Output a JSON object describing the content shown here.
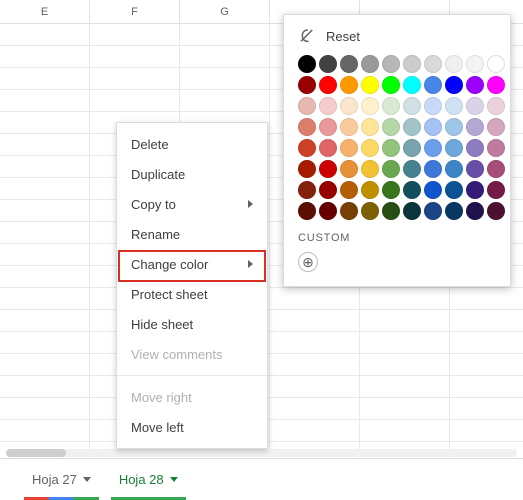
{
  "columns": [
    "E",
    "F",
    "G"
  ],
  "tabs": [
    {
      "label": "Hoja 27",
      "active": false
    },
    {
      "label": "Hoja 28",
      "active": true
    }
  ],
  "context_menu": {
    "delete": "Delete",
    "duplicate": "Duplicate",
    "copy_to": "Copy to",
    "rename": "Rename",
    "change_color": "Change color",
    "protect": "Protect sheet",
    "hide": "Hide sheet",
    "view_comments": "View comments",
    "move_right": "Move right",
    "move_left": "Move left"
  },
  "color_picker": {
    "reset": "Reset",
    "custom_label": "CUSTOM"
  },
  "chart_data": {
    "type": "table",
    "title": "Color swatches",
    "columns": 10,
    "rows": [
      [
        "#000000",
        "#434343",
        "#666666",
        "#999999",
        "#b7b7b7",
        "#cccccc",
        "#d9d9d9",
        "#efefef",
        "#f3f3f3",
        "#ffffff"
      ],
      [
        "#980000",
        "#ff0000",
        "#ff9900",
        "#ffff00",
        "#00ff00",
        "#00ffff",
        "#4a86e8",
        "#0000ff",
        "#9900ff",
        "#ff00ff"
      ],
      [
        "#e6b8af",
        "#f4cccc",
        "#fce5cd",
        "#fff2cc",
        "#d9ead3",
        "#d0e0e3",
        "#c9daf8",
        "#cfe2f3",
        "#d9d2e9",
        "#ead1dc"
      ],
      [
        "#dd7e6b",
        "#ea9999",
        "#f9cb9c",
        "#ffe599",
        "#b6d7a8",
        "#a2c4c9",
        "#a4c2f4",
        "#9fc5e8",
        "#b4a7d6",
        "#d5a6bd"
      ],
      [
        "#cc4125",
        "#e06666",
        "#f6b26b",
        "#ffd966",
        "#93c47d",
        "#76a5af",
        "#6d9eeb",
        "#6fa8dc",
        "#8e7cc3",
        "#c27ba0"
      ],
      [
        "#a61c00",
        "#cc0000",
        "#e69138",
        "#f1c232",
        "#6aa84f",
        "#45818e",
        "#3c78d8",
        "#3d85c6",
        "#674ea7",
        "#a64d79"
      ],
      [
        "#85200c",
        "#990000",
        "#b45f06",
        "#bf9000",
        "#38761d",
        "#134f5c",
        "#1155cc",
        "#0b5394",
        "#351c75",
        "#741b47"
      ],
      [
        "#5b0f00",
        "#660000",
        "#783f04",
        "#7f6000",
        "#274e13",
        "#0c343d",
        "#1c4587",
        "#073763",
        "#20124d",
        "#4c1130"
      ]
    ]
  }
}
